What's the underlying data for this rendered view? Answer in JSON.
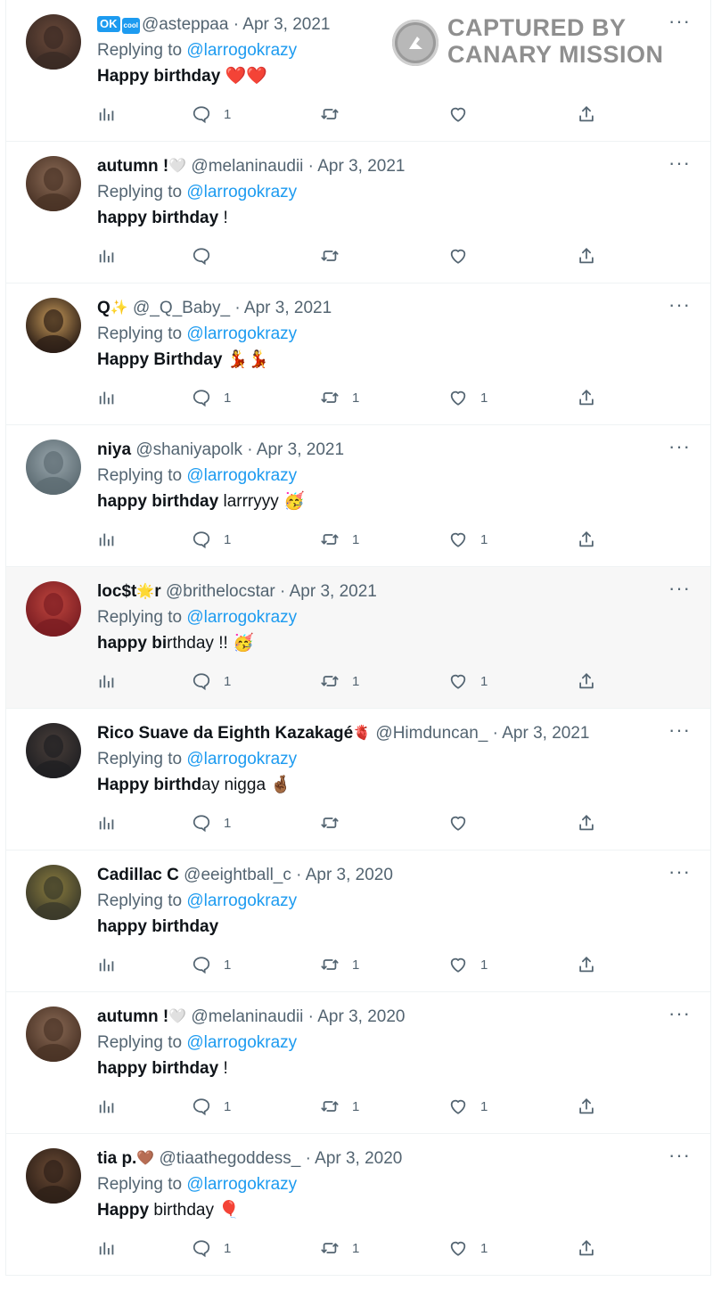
{
  "watermark": {
    "line1": "CAPTURED BY",
    "line2": "CANARY MISSION"
  },
  "reply_prefix": "Replying to",
  "reply_to": "@larrogokrazy",
  "colors": {
    "accent": "#1d9bf0",
    "muted": "#536471",
    "text": "#0f1419",
    "heart": "#e0245e"
  },
  "tweets": [
    {
      "badges": [
        "OK",
        "cool"
      ],
      "name": "",
      "name_emoji": "",
      "handle": "@asteppaa",
      "sep": "·",
      "date": "Apr 3, 2021",
      "text_bold": "Happy birthday",
      "text_rest": " ",
      "text_emoji": "❤️❤️",
      "counts": {
        "reply": "1",
        "retweet": "",
        "like": ""
      },
      "highlight": false
    },
    {
      "name": "autumn !",
      "name_emoji": "🤍",
      "handle": "@melaninaudii",
      "sep": "·",
      "date": "Apr 3, 2021",
      "text_bold": "happy birthday",
      "text_rest": " !",
      "text_emoji": "",
      "counts": {
        "reply": "",
        "retweet": "",
        "like": ""
      },
      "highlight": false
    },
    {
      "name": "Q",
      "name_emoji": "✨",
      "handle": "@_Q_Baby_",
      "sep": "·",
      "date": "Apr 3, 2021",
      "text_bold": "Happy Birthday",
      "text_rest": " ",
      "text_emoji": "💃💃",
      "counts": {
        "reply": "1",
        "retweet": "1",
        "like": "1"
      },
      "highlight": false
    },
    {
      "name": "niya",
      "name_emoji": "",
      "handle": "@shaniyapolk",
      "sep": "·",
      "date": "Apr 3, 2021",
      "text_bold": "happy birthday",
      "text_rest": " larrryyy ",
      "text_emoji": "🥳",
      "counts": {
        "reply": "1",
        "retweet": "1",
        "like": "1"
      },
      "highlight": false
    },
    {
      "name": "loc$t",
      "name_emoji": "🌟",
      "name_after": "r",
      "handle": "@brithelocstar",
      "sep": "·",
      "date": "Apr 3, 2021",
      "text_bold": "happy bi",
      "text_rest": "rthday !! ",
      "text_emoji": "🥳",
      "counts": {
        "reply": "1",
        "retweet": "1",
        "like": "1"
      },
      "highlight": true
    },
    {
      "name": "Rico Suave da Eighth Kazakagé",
      "name_emoji": "🫀",
      "handle": "@Himduncan_",
      "sep": "·",
      "date": "Apr 3, 2021",
      "text_bold": "Happy birthd",
      "text_rest": "ay nigga ",
      "text_emoji": "🤞🏾",
      "counts": {
        "reply": "1",
        "retweet": "",
        "like": ""
      },
      "highlight": false
    },
    {
      "name": "Cadillac C",
      "name_emoji": "",
      "handle": "@eeightball_c",
      "sep": "·",
      "date": "Apr 3, 2020",
      "text_bold": "happy birthday",
      "text_rest": "",
      "text_emoji": "",
      "counts": {
        "reply": "1",
        "retweet": "1",
        "like": "1"
      },
      "highlight": false
    },
    {
      "name": "autumn !",
      "name_emoji": "🤍",
      "handle": "@melaninaudii",
      "sep": "·",
      "date": "Apr 3, 2020",
      "text_bold": "happy birthday",
      "text_rest": " !",
      "text_emoji": "",
      "counts": {
        "reply": "1",
        "retweet": "1",
        "like": "1"
      },
      "highlight": false
    },
    {
      "name": "tia p.",
      "name_emoji": "🤎",
      "handle": "@tiaathegoddess_",
      "sep": "·",
      "date": "Apr 3, 2020",
      "text_bold": "Happy",
      "text_rest": " birthday ",
      "text_emoji": "🎈",
      "counts": {
        "reply": "1",
        "retweet": "1",
        "like": "1"
      },
      "highlight": false
    }
  ],
  "icons": {
    "views": "analytics-icon",
    "reply": "reply-icon",
    "retweet": "retweet-icon",
    "like": "heart-icon",
    "share": "share-icon",
    "more": "more-options-icon"
  }
}
